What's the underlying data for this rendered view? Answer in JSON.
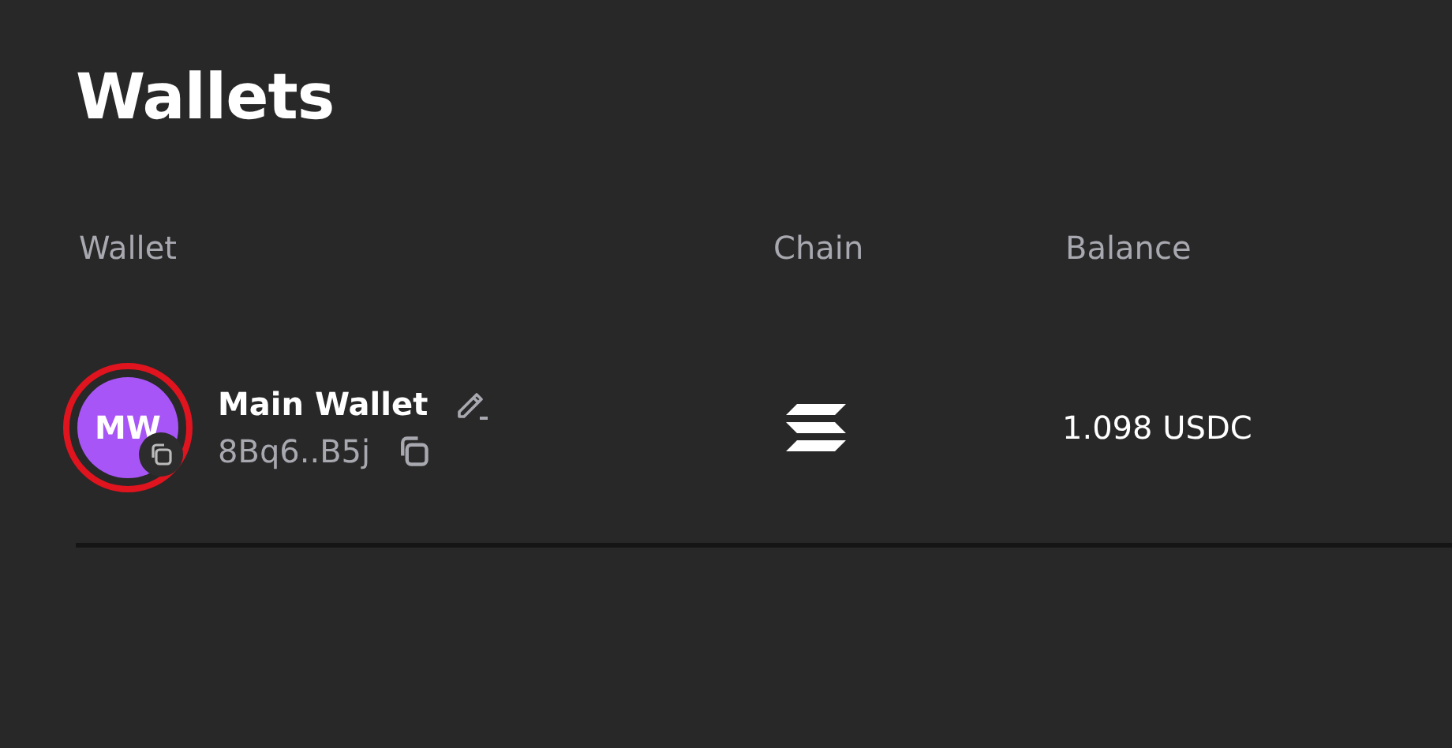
{
  "title": "Wallets",
  "table": {
    "columns": [
      "Wallet",
      "Chain",
      "Balance"
    ],
    "rows": [
      {
        "avatar": {
          "initials": "MW",
          "color": "#a855f7",
          "highlighted": true
        },
        "name": "Main Wallet",
        "address": "8Bq6..B5j",
        "chain": {
          "kind": "logo"
        },
        "balance": "1.098 USDC"
      }
    ]
  }
}
